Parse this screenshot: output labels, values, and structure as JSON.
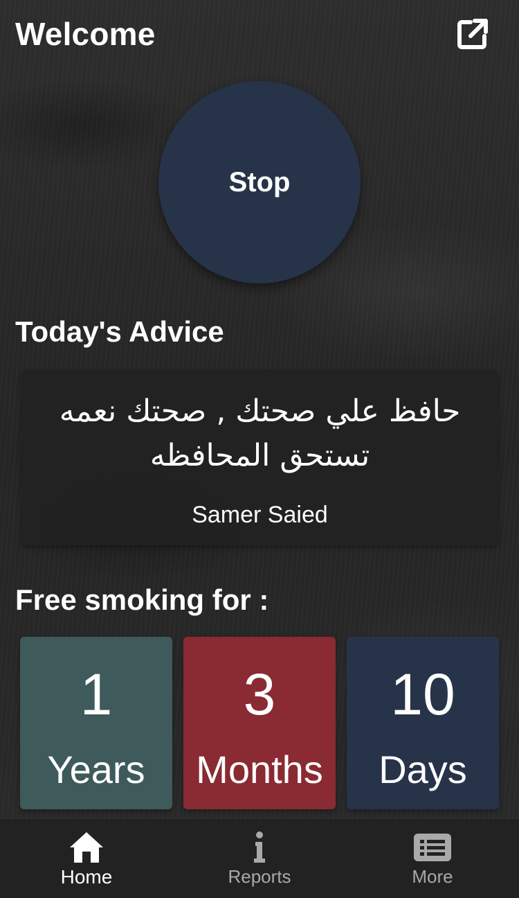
{
  "header": {
    "title": "Welcome",
    "share_icon": "external-link-icon"
  },
  "stop_button": {
    "label": "Stop",
    "color": "#273349"
  },
  "advice": {
    "section_title": "Today's Advice",
    "text": "حافظ علي صحتك , صحتك نعمه تستحق المحافظه",
    "author": "Samer Saied"
  },
  "free_smoking": {
    "section_title": "Free smoking for :",
    "counters": [
      {
        "value": "1",
        "unit": "Years",
        "color": "#3e5a5a"
      },
      {
        "value": "3",
        "unit": "Months",
        "color": "#8a2a32"
      },
      {
        "value": "10",
        "unit": "Days",
        "color": "#273349"
      }
    ]
  },
  "tabbar": {
    "tabs": [
      {
        "label": "Home",
        "icon": "home-icon",
        "active": true
      },
      {
        "label": "Reports",
        "icon": "info-icon",
        "active": false
      },
      {
        "label": "More",
        "icon": "list-icon",
        "active": false
      }
    ]
  }
}
